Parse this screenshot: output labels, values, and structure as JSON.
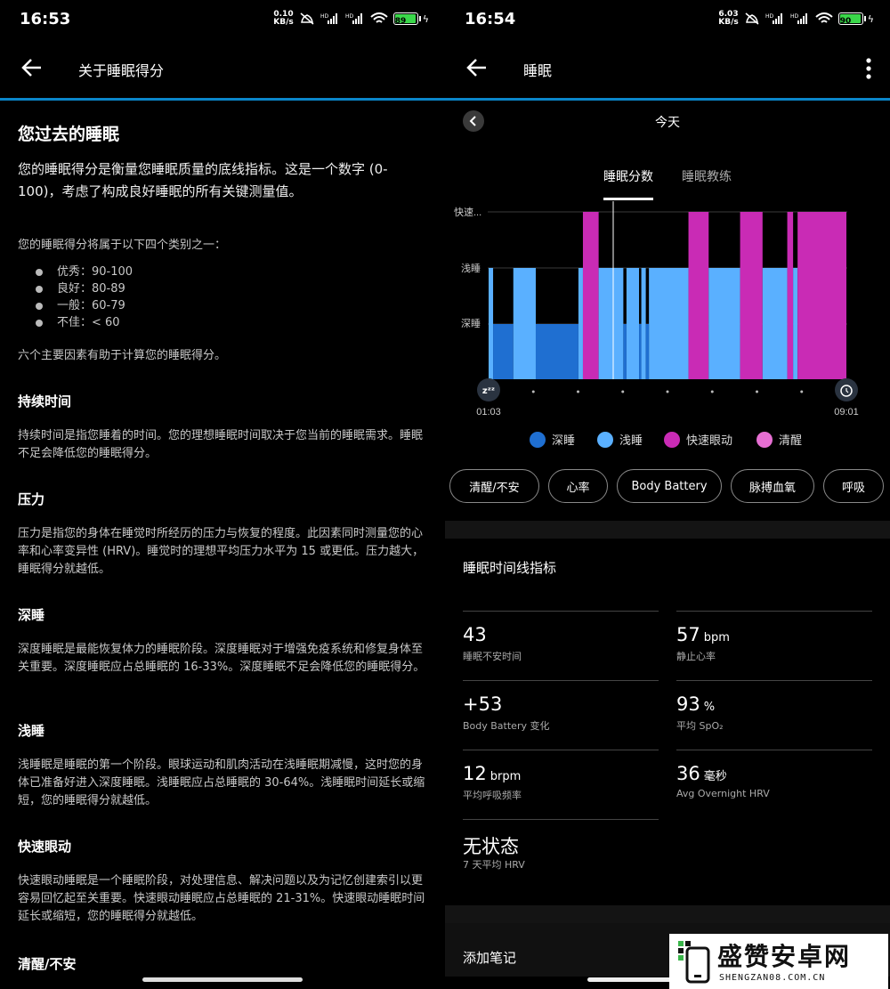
{
  "left": {
    "status": {
      "time": "16:53",
      "net_value": "0.10",
      "net_unit": "KB/s",
      "battery": "89"
    },
    "appbar": {
      "title": "关于睡眠得分"
    },
    "heading": "您过去的睡眠",
    "intro": "您的睡眠得分是衡量您睡眠质量的底线指标。这是一个数字 (0-100)，考虑了构成良好睡眠的所有关键测量值。",
    "categories_intro": "您的睡眠得分将属于以下四个类别之一：",
    "categories": [
      "优秀：90-100",
      "良好：80-89",
      "一般：60-79",
      "不佳：< 60"
    ],
    "factors_intro": "六个主要因素有助于计算您的睡眠得分。",
    "sections": [
      {
        "title": "持续时间",
        "body": "持续时间是指您睡着的时间。您的理想睡眠时间取决于您当前的睡眠需求。睡眠不足会降低您的睡眠得分。"
      },
      {
        "title": "压力",
        "body": "压力是指您的身体在睡觉时所经历的压力与恢复的程度。此因素同时测量您的心率和心率变异性 (HRV)。睡觉时的理想平均压力水平为 15 或更低。压力越大，睡眠得分就越低。"
      },
      {
        "title": "深睡",
        "body": "深度睡眠是最能恢复体力的睡眠阶段。深度睡眠对于增强免疫系统和修复身体至关重要。深度睡眠应占总睡眠的 16-33%。深度睡眠不足会降低您的睡眠得分。"
      },
      {
        "title": "浅睡",
        "body": "浅睡眠是睡眠的第一个阶段。眼球运动和肌肉活动在浅睡眠期减慢，这时您的身体已准备好进入深度睡眠。浅睡眠应占总睡眠的 30-64%。浅睡眠时间延长或缩短，您的睡眠得分就越低。"
      },
      {
        "title": "快速眼动",
        "body": "快速眼动睡眠是一个睡眠阶段，对处理信息、解决问题以及为记忆创建索引以更容易回忆起至关重要。快速眼动睡眠应占总睡眠的 21-31%。快速眼动睡眠时间延长或缩短，您的睡眠得分就越低。"
      },
      {
        "title": "清醒/不安",
        "body": ""
      }
    ]
  },
  "right": {
    "status": {
      "time": "16:54",
      "net_value": "6.03",
      "net_unit": "KB/s",
      "battery": "90"
    },
    "appbar": {
      "title": "睡眠"
    },
    "date": "今天",
    "tabs": [
      "睡眠分数",
      "睡眠教练"
    ],
    "chart_data": {
      "type": "timeline",
      "y_categories": [
        "深睡",
        "浅睡",
        "快速..."
      ],
      "x_start_label": "01:03",
      "x_end_label": "09:01",
      "x_range_hours": [
        1.05,
        9.0167
      ],
      "segments": [
        {
          "stage": "light",
          "start": 1.05,
          "end": 1.15
        },
        {
          "stage": "deep",
          "start": 1.15,
          "end": 1.6
        },
        {
          "stage": "light",
          "start": 1.6,
          "end": 2.1
        },
        {
          "stage": "deep",
          "start": 2.1,
          "end": 3.05
        },
        {
          "stage": "light",
          "start": 3.05,
          "end": 3.15
        },
        {
          "stage": "rem",
          "start": 3.15,
          "end": 3.5
        },
        {
          "stage": "light",
          "start": 3.5,
          "end": 4.05
        },
        {
          "stage": "deep",
          "start": 4.05,
          "end": 4.12
        },
        {
          "stage": "light",
          "start": 4.12,
          "end": 4.4
        },
        {
          "stage": "deep",
          "start": 4.4,
          "end": 4.45
        },
        {
          "stage": "light",
          "start": 4.45,
          "end": 4.55
        },
        {
          "stage": "deep",
          "start": 4.55,
          "end": 4.62
        },
        {
          "stage": "light",
          "start": 4.62,
          "end": 5.5
        },
        {
          "stage": "rem",
          "start": 5.5,
          "end": 5.95
        },
        {
          "stage": "light",
          "start": 5.95,
          "end": 6.65
        },
        {
          "stage": "rem",
          "start": 6.65,
          "end": 7.15
        },
        {
          "stage": "light",
          "start": 7.15,
          "end": 7.7
        },
        {
          "stage": "rem",
          "start": 7.7,
          "end": 7.83
        },
        {
          "stage": "light",
          "start": 7.83,
          "end": 7.93
        },
        {
          "stage": "rem",
          "start": 7.93,
          "end": 9.0167
        }
      ],
      "colors": {
        "deep": "#1f6fd1",
        "light": "#5ab0ff",
        "rem": "#c92bb5",
        "awake": "#e66fd2"
      }
    },
    "legend": [
      {
        "label": "深睡",
        "color": "#1f6fd1"
      },
      {
        "label": "浅睡",
        "color": "#5ab0ff"
      },
      {
        "label": "快速眼动",
        "color": "#c92bb5"
      },
      {
        "label": "清醒",
        "color": "#e66fd2"
      }
    ],
    "chips": [
      "清醒/不安",
      "心率",
      "Body Battery",
      "脉搏血氧",
      "呼吸"
    ],
    "metrics_title": "睡眠时间线指标",
    "metrics": [
      {
        "value": "43",
        "unit": "",
        "label": "睡眠不安时间"
      },
      {
        "value": "57",
        "unit": "bpm",
        "label": "静止心率"
      },
      {
        "value": "+53",
        "unit": "",
        "label": "Body Battery 变化"
      },
      {
        "value": "93",
        "unit": "%",
        "label": "平均 SpO₂"
      },
      {
        "value": "12",
        "unit": "brpm",
        "label": "平均呼吸频率"
      },
      {
        "value": "36",
        "unit": "毫秒",
        "label": "Avg Overnight HRV"
      },
      {
        "value": "无状态",
        "unit": "",
        "label": "7 天平均 HRV"
      }
    ],
    "note_label": "添加笔记"
  },
  "watermark": {
    "main": "盛赞安卓网",
    "sub": "SHENGZAN08.COM.CN"
  }
}
